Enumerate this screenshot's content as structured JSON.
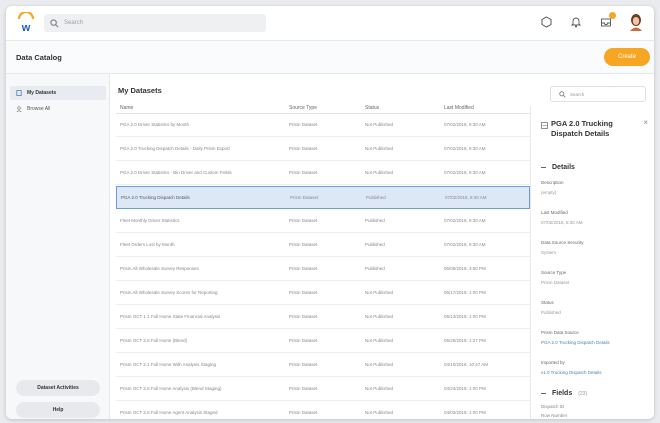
{
  "header": {
    "search_placeholder": "Search"
  },
  "page": {
    "title": "Data Catalog",
    "create_label": "Create"
  },
  "sidebar": {
    "items": [
      {
        "label": "My Datasets",
        "active": true
      },
      {
        "label": "Browse All",
        "active": false
      }
    ],
    "buttons": [
      "Dataset Activities",
      "Help"
    ]
  },
  "main": {
    "title": "My Datasets",
    "search_placeholder": "Search",
    "columns": [
      "Name",
      "Source Type",
      "Status",
      "Last Modified"
    ],
    "rows": [
      {
        "name": "PGA 2.0 Driver Statistics by Month",
        "type": "Prism Dataset",
        "status": "Not Published",
        "modified": "07/02/2018, 8:30 AM",
        "selected": false
      },
      {
        "name": "PGA 2.0 Trucking Dispatch Details - Daily Prism Export",
        "type": "Prism Dataset",
        "status": "Not Published",
        "modified": "07/02/2018, 8:30 AM",
        "selected": false
      },
      {
        "name": "PGA 2.0 Driver Statistics - Bin Driver and Custom Fields",
        "type": "Prism Dataset",
        "status": "Not Published",
        "modified": "07/02/2018, 8:30 AM",
        "selected": false
      },
      {
        "name": "PGA 2.0 Trucking Dispatch Details",
        "type": "Prism Dataset",
        "status": "Published",
        "modified": "07/02/2018, 8:30 AM",
        "selected": true
      },
      {
        "name": "Fleet Monthly Driver Statistics",
        "type": "Prism Dataset",
        "status": "Published",
        "modified": "07/02/2018, 8:30 AM",
        "selected": false
      },
      {
        "name": "Fleet Orders Lost by Month",
        "type": "Prism Dataset",
        "status": "Published",
        "modified": "07/02/2018, 8:30 AM",
        "selected": false
      },
      {
        "name": "Prism All Wholesale Survey Responses",
        "type": "Prism Dataset",
        "status": "Published",
        "modified": "06/08/2018, 3:50 PM",
        "selected": false
      },
      {
        "name": "Prism All Wholesale Survey Scores for Reporting",
        "type": "Prism Dataset",
        "status": "Not Published",
        "modified": "06/17/2018, 1:00 PM",
        "selected": false
      },
      {
        "name": "Prism OCT 1.1 Full Home State Financial Analysis",
        "type": "Prism Dataset",
        "status": "Not Published",
        "modified": "05/13/2018, 1:00 PM",
        "selected": false
      },
      {
        "name": "Prism OCT 2.6 Full Home (Blend)",
        "type": "Prism Dataset",
        "status": "Not Published",
        "modified": "05/25/2018, 1:27 PM",
        "selected": false
      },
      {
        "name": "Prism OCT 2.1 Full Home With Analysis Staging",
        "type": "Prism Dataset",
        "status": "Not Published",
        "modified": "04/10/2018, 10:47 AM",
        "selected": false
      },
      {
        "name": "Prism OCT 2.6 Full Home Analysis (Blend Staging)",
        "type": "Prism Dataset",
        "status": "Not Published",
        "modified": "04/24/2018, 1:00 PM",
        "selected": false
      },
      {
        "name": "Prism OCT 2.6 Full Home Agent Analysis Staged",
        "type": "Prism Dataset",
        "status": "Not Published",
        "modified": "04/03/2018, 1:00 PM",
        "selected": false
      }
    ]
  },
  "details": {
    "title": "PGA 2.0 Trucking Dispatch Details",
    "section_details": "Details",
    "fields": [
      {
        "label": "Description",
        "value": "(empty)",
        "link": false
      },
      {
        "label": "Last Modified",
        "value": "07/02/2018, 8:30 AM",
        "link": false
      },
      {
        "label": "Data Source Security",
        "value": "System",
        "link": false
      },
      {
        "label": "Source Type",
        "value": "Prism Dataset",
        "link": false
      },
      {
        "label": "Status",
        "value": "Published",
        "link": false
      },
      {
        "label": "Prism Data Source",
        "value": "PGA 2.0 Trucking Dispatch Details",
        "link": true
      },
      {
        "label": "Imported by",
        "value": "v1.0 Trucking Dispatch Details",
        "link": true
      }
    ],
    "section_fields": "Fields",
    "fields_count": "(23)",
    "field_items": [
      "Dispatch ID",
      "Row Number"
    ]
  }
}
